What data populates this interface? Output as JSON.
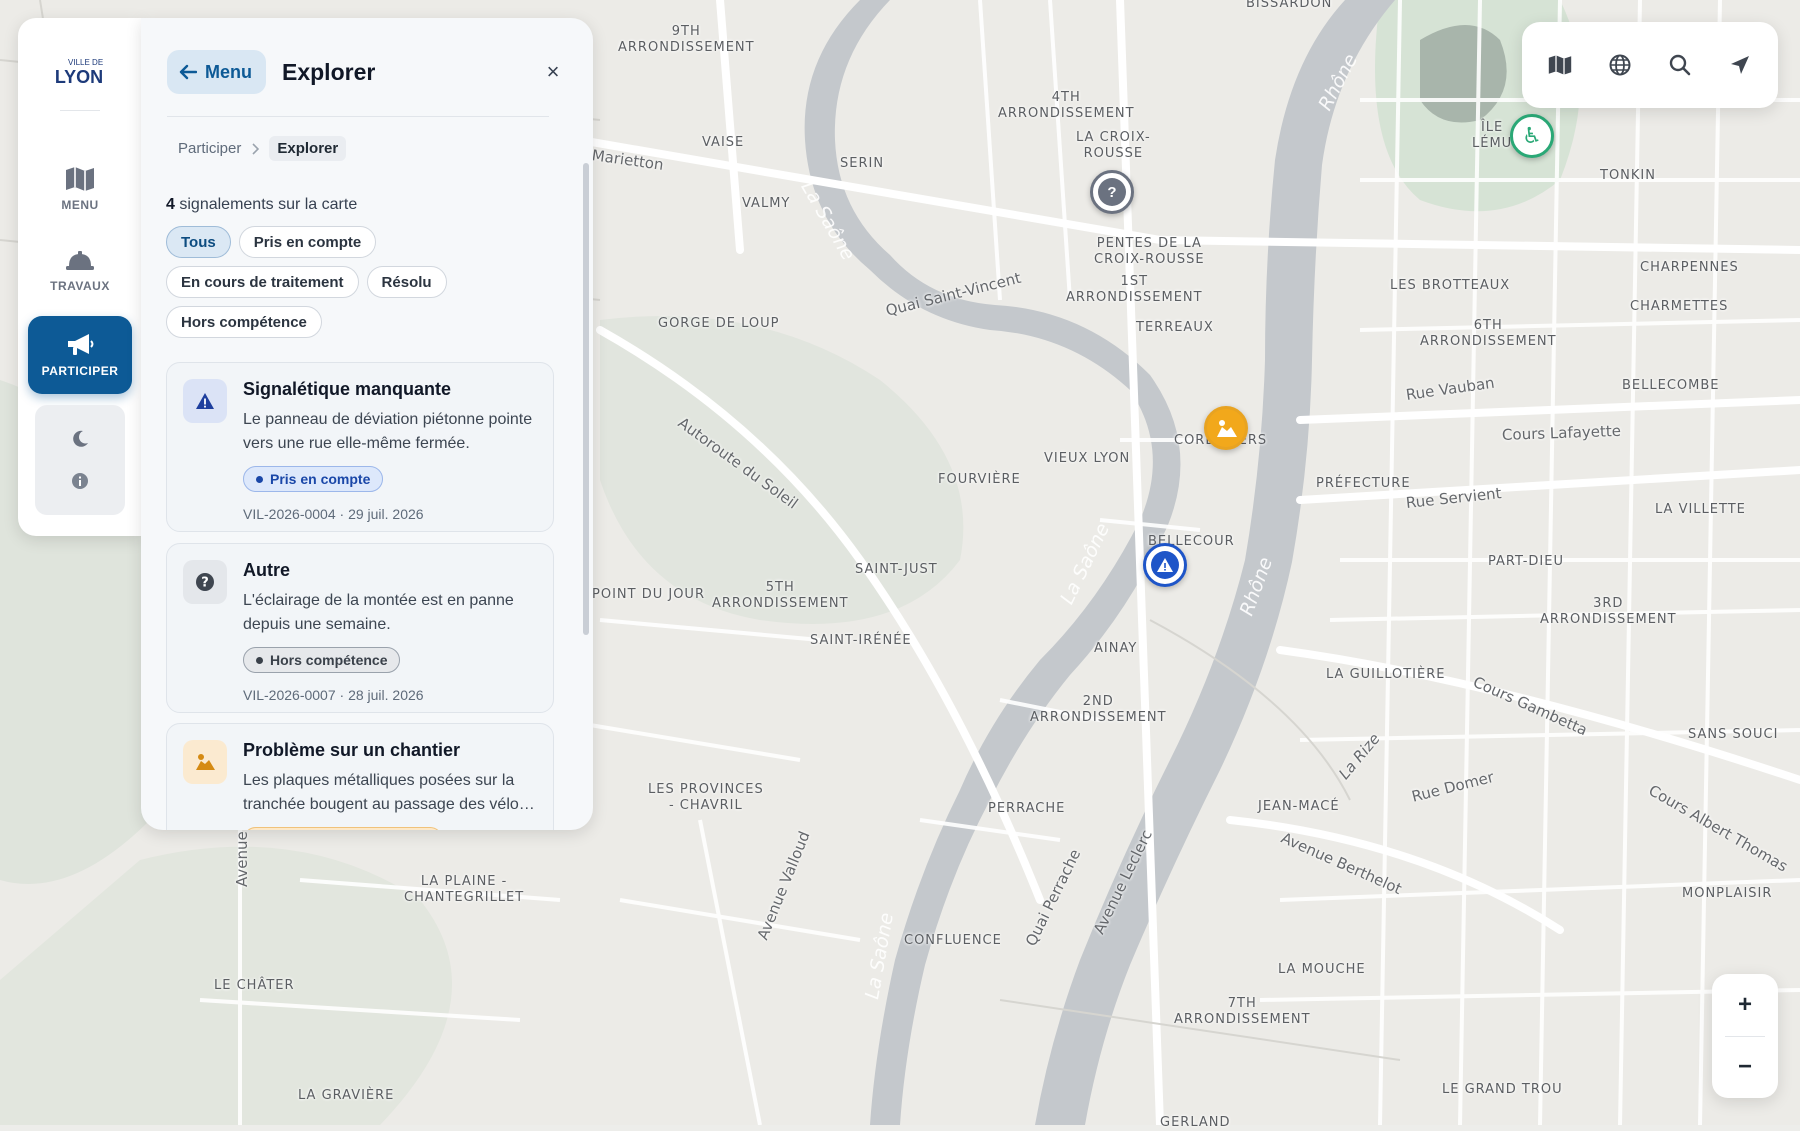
{
  "map": {
    "district_labels": [
      "9th\nArrondissement",
      "4th\nArrondissement",
      "La Croix-\nRousse",
      "Vaise",
      "Serin",
      "Valmy",
      "Pentes de la\nCroix-Rousse",
      "1st\nArrondissement",
      "Terreaux",
      "Gorge de Loup",
      "Les Brotteaux",
      "6th\nArrondissement",
      "Charpennes",
      "Charmettes",
      "Tonkin",
      "Île\nLému",
      "Cordeliers",
      "Vieux Lyon",
      "Fourvière",
      "Préfecture",
      "Bellecombe",
      "La Villette",
      "Part-Dieu",
      "Bellecour",
      "Saint-Just",
      "5th\nArrondissement",
      "Saint-Irénée",
      "Point du Jour",
      "Ainay",
      "2nd\nArrondissement",
      "La Guillotière",
      "3rd\nArrondissement",
      "Sans Souci",
      "Les Provinces\n- Chavril",
      "Perrache",
      "Jean-Macé",
      "Monplaisir",
      "La Plaine -\nChantegrillet",
      "Confluence",
      "La Mouche",
      "7th\nArrondissement",
      "Le Châter",
      "La Gravière",
      "Le Grand Trou",
      "Gerland",
      "Bissardon"
    ],
    "street_labels": [
      "Marietton",
      "Quai Saint-Vincent",
      "Autoroute du Soleil",
      "Rue Vauban",
      "Cours Lafayette",
      "Rue Servient",
      "Cours Gambetta",
      "Rue Domer",
      "Avenue Berthelot",
      "Cours Albert Thomas",
      "Avenue Valloud",
      "Quai Perrache",
      "Avenue Leclerc",
      "Avenue",
      "La Rize"
    ],
    "river_labels": [
      "La Saône",
      "Rhône"
    ],
    "markers": [
      {
        "name": "marker-question",
        "icon": "question-icon",
        "color": "#6b7280"
      },
      {
        "name": "marker-construction",
        "icon": "construction-icon",
        "color": "#e8a321"
      },
      {
        "name": "marker-warning",
        "icon": "warning-icon",
        "color": "#1e55c8"
      },
      {
        "name": "marker-accessibility",
        "icon": "wheelchair-icon",
        "color": "#2aa876"
      }
    ]
  },
  "sidebar": {
    "logo_small": "VILLE DE",
    "logo_big": "LYON",
    "items": [
      {
        "label": "MENU",
        "icon": "map-icon"
      },
      {
        "label": "TRAVAUX",
        "icon": "helmet-icon"
      },
      {
        "label": "PARTICIPER",
        "icon": "megaphone-icon"
      }
    ]
  },
  "panel": {
    "menu_label": "Menu",
    "title": "Explorer",
    "close": "×",
    "breadcrumb": [
      "Participer",
      "Explorer"
    ],
    "count": "4",
    "count_text": "signalements sur la carte",
    "filters": [
      "Tous",
      "Pris en compte",
      "En cours de traitement",
      "Résolu",
      "Hors compétence"
    ],
    "cards": [
      {
        "title": "Signalétique manquante",
        "desc": "Le panneau de déviation piétonne pointe vers une rue elle-même fermée.",
        "status": "Pris en compte",
        "ref": "VIL-2026-0004 · 29 juil. 2026"
      },
      {
        "title": "Autre",
        "desc": "L'éclairage de la montée est en panne depuis une semaine.",
        "status": "Hors compétence",
        "ref": "VIL-2026-0007 · 28 juil. 2026"
      },
      {
        "title": "Problème sur un chantier",
        "desc": "Les plaques métalliques posées sur la tranchée bougent au passage des vélo…",
        "status": "",
        "ref": ""
      }
    ]
  },
  "zoom": {
    "in": "+",
    "out": "−"
  }
}
